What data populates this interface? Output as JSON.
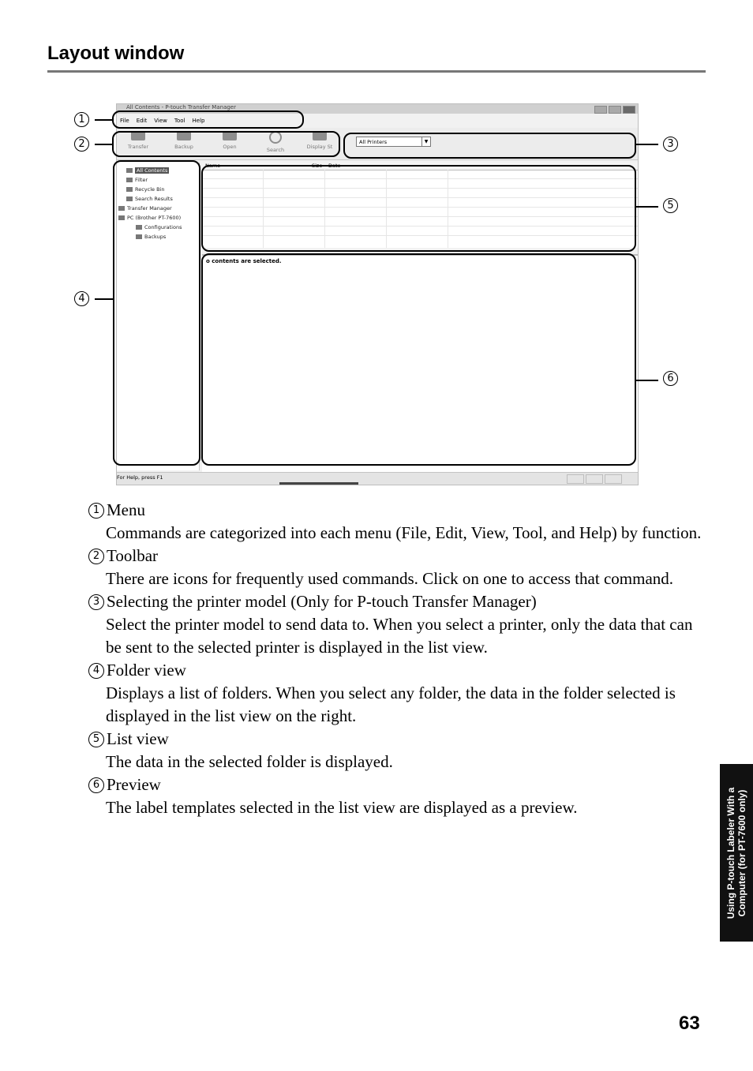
{
  "page": {
    "section_title": "Layout window",
    "page_number": "63",
    "side_tab": [
      "Using P-touch Labeler With a",
      "Computer (for PT-7600 only)"
    ]
  },
  "screenshot": {
    "window_title": "All Contents - P-touch Transfer Manager",
    "menu": [
      "File",
      "Edit",
      "View",
      "Tool",
      "Help"
    ],
    "toolbar": [
      "Transfer",
      "Backup",
      "Open",
      "Search",
      "Display St"
    ],
    "printer_select": "All Printers",
    "folders": [
      {
        "label": "All Contents",
        "selected": true
      },
      {
        "label": "Filter"
      },
      {
        "label": "Recycle Bin"
      },
      {
        "label": "Search Results"
      },
      {
        "label": "Transfer Manager"
      },
      {
        "label": "PC (Brother PT-7600)"
      },
      {
        "label": "Configurations"
      },
      {
        "label": "Backups"
      }
    ],
    "list_columns": [
      "Name",
      "Size",
      "Date"
    ],
    "preview_message": "o contents are selected.",
    "status_text": "For Help, press F1"
  },
  "callouts": [
    "1",
    "2",
    "3",
    "4",
    "5",
    "6"
  ],
  "items": [
    {
      "num": "1",
      "title": "Menu",
      "body": "Commands are categorized into each menu (File, Edit, View, Tool, and Help) by function."
    },
    {
      "num": "2",
      "title": "Toolbar",
      "body": "There are icons for frequently used commands. Click on one to access that command."
    },
    {
      "num": "3",
      "title": "Selecting the printer model (Only for P-touch Transfer Manager)",
      "body": "Select the printer model to send data to. When you select a printer, only the data that can be sent to the selected printer is displayed in the list view."
    },
    {
      "num": "4",
      "title": "Folder view",
      "body": "Displays a list of folders. When you select any folder, the data in the folder selected is displayed in the list view on the right."
    },
    {
      "num": "5",
      "title": "List view",
      "body": "The data in the selected folder is displayed."
    },
    {
      "num": "6",
      "title": "Preview",
      "body": "The label templates selected in the list view are displayed as a preview."
    }
  ]
}
